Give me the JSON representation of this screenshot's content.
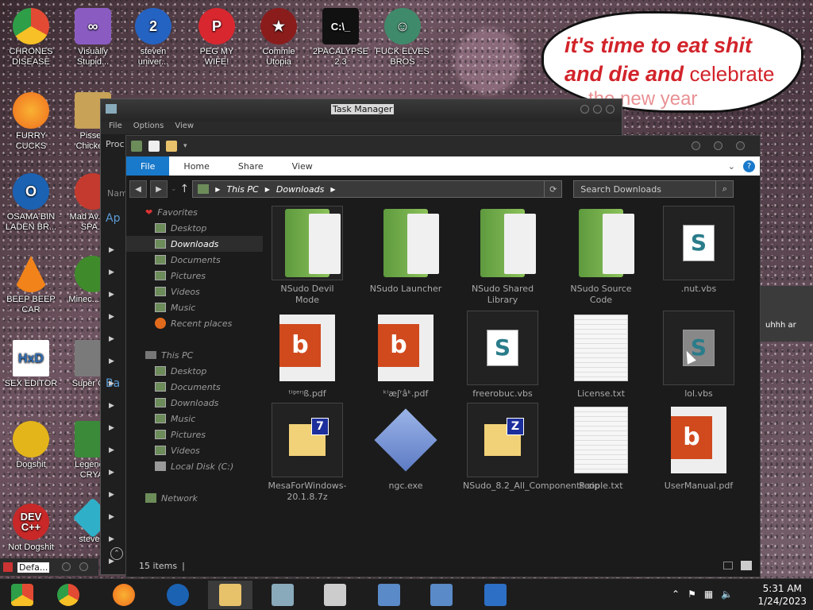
{
  "desktop": {
    "icons": [
      {
        "label": "CHRONES DISEASE",
        "color": "#e34a33"
      },
      {
        "label": "Visually Stupid...",
        "color": "#8a5cc2"
      },
      {
        "label": "steven univer...",
        "color": "#2563c2"
      },
      {
        "label": "PEG MY WIFE!",
        "color": "#d8272f"
      },
      {
        "label": "Commie Utopia",
        "color": "#8b1c1c"
      },
      {
        "label": "2PACALYPSE 2.3",
        "color": "#111111"
      },
      {
        "label": "FUCK ELVES BROS",
        "color": "#3f8a6b"
      },
      {
        "label": "FURRY CUCKS",
        "color": "#ef6b1d"
      },
      {
        "label": "Pissed Chicke...",
        "color": "#c7a257"
      },
      {
        "label": "OSAMA BIN LADEN BR...",
        "color": "#1b62b3"
      },
      {
        "label": "Mad Av... IN SPA...",
        "color": "#c43a2e"
      },
      {
        "label": "BEEP BEEP CAR",
        "color": "#f1831a"
      },
      {
        "label": "Minec... Bird",
        "color": "#3f8a2b"
      },
      {
        "label": "SEX EDITOR",
        "color": "#2f6db5"
      },
      {
        "label": "Super Cr...",
        "color": "#7a7a7a"
      },
      {
        "label": "Dogshit",
        "color": "#e3b51a"
      },
      {
        "label": "Legend... CRYAI",
        "color": "#3a8a3a"
      },
      {
        "label": "Not Dogshit",
        "color": "#c82828"
      },
      {
        "label": "steve...",
        "color": "#2fb0c8"
      }
    ],
    "speech": {
      "line1": "it's time to eat shit",
      "line2a": "and die and",
      "line2b": "celebrate",
      "line3": "the new year"
    }
  },
  "task_manager": {
    "title": "Task Manager",
    "menu": [
      "File",
      "Options",
      "View"
    ],
    "proc_tab": "Proc",
    "name_col": "Nam",
    "ap_label": "Ap",
    "ba_label": "Ba"
  },
  "explorer": {
    "ribbon": {
      "file": "File",
      "home": "Home",
      "share": "Share",
      "view": "View"
    },
    "path": [
      "This PC",
      "Downloads"
    ],
    "search_placeholder": "Search Downloads",
    "nav": {
      "favorites": "Favorites",
      "fav_items": [
        "Desktop",
        "Downloads",
        "Documents",
        "Pictures",
        "Videos",
        "Music",
        "Recent places"
      ],
      "this_pc": "This PC",
      "pc_items": [
        "Desktop",
        "Documents",
        "Downloads",
        "Music",
        "Pictures",
        "Videos",
        "Local Disk (C:)"
      ],
      "network": "Network"
    },
    "files": [
      {
        "name": "NSudo Devil Mode",
        "kind": "folder"
      },
      {
        "name": "NSudo Launcher",
        "kind": "folder"
      },
      {
        "name": "NSudo Shared Library",
        "kind": "folder"
      },
      {
        "name": "NSudo Source Code",
        "kind": "folder"
      },
      {
        "name": ".nut.vbs",
        "kind": "vbs"
      },
      {
        "name": "ᵗⁱᵍᵉʳᵎß.pdf",
        "kind": "pdf"
      },
      {
        "name": "ᵏⁱæʃʳâᵏ.pdf",
        "kind": "pdf"
      },
      {
        "name": "freerobuc.vbs",
        "kind": "vbs"
      },
      {
        "name": "License.txt",
        "kind": "txt"
      },
      {
        "name": "lol.vbs",
        "kind": "vbs"
      },
      {
        "name": "MesaForWindows-20.1.8.7z",
        "kind": "7z"
      },
      {
        "name": "ngc.exe",
        "kind": "exe"
      },
      {
        "name": "NSudo_8.2_All_Components.zip",
        "kind": "zip"
      },
      {
        "name": "People.txt",
        "kind": "txt"
      },
      {
        "name": "UserManual.pdf",
        "kind": "pdf"
      }
    ],
    "status": "15 items"
  },
  "taskbar": {
    "mini_title": "Defa...",
    "time": "5:31 AM",
    "date": "1/24/2023"
  },
  "chat": {
    "text": "uhhh ar"
  }
}
